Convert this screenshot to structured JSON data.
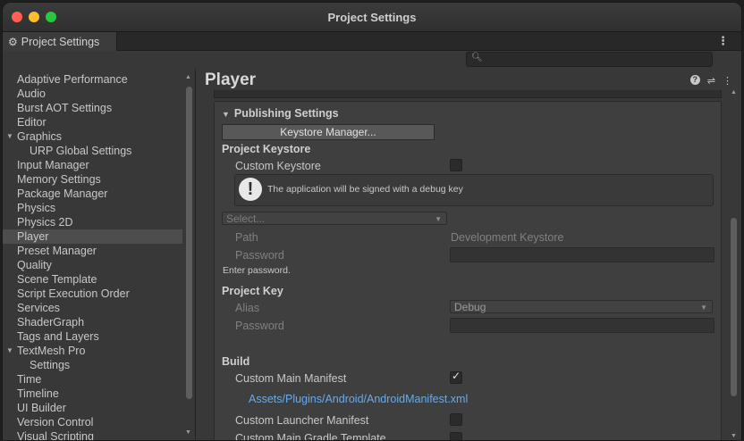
{
  "window": {
    "title": "Project Settings"
  },
  "tab": {
    "label": "Project Settings"
  },
  "search": {
    "placeholder": ""
  },
  "sidebar": {
    "items": [
      {
        "label": "Adaptive Performance"
      },
      {
        "label": "Audio"
      },
      {
        "label": "Burst AOT Settings"
      },
      {
        "label": "Editor"
      },
      {
        "label": "Graphics"
      },
      {
        "label": "URP Global Settings"
      },
      {
        "label": "Input Manager"
      },
      {
        "label": "Memory Settings"
      },
      {
        "label": "Package Manager"
      },
      {
        "label": "Physics"
      },
      {
        "label": "Physics 2D"
      },
      {
        "label": "Player"
      },
      {
        "label": "Preset Manager"
      },
      {
        "label": "Quality"
      },
      {
        "label": "Scene Template"
      },
      {
        "label": "Script Execution Order"
      },
      {
        "label": "Services"
      },
      {
        "label": "ShaderGraph"
      },
      {
        "label": "Tags and Layers"
      },
      {
        "label": "TextMesh Pro"
      },
      {
        "label": "Settings"
      },
      {
        "label": "Time"
      },
      {
        "label": "Timeline"
      },
      {
        "label": "UI Builder"
      },
      {
        "label": "Version Control"
      },
      {
        "label": "Visual Scripting"
      }
    ],
    "selected": "Player"
  },
  "content": {
    "title": "Player",
    "publishing": {
      "header": "Publishing Settings",
      "keystore_manager_button": "Keystore Manager...",
      "project_keystore_label": "Project Keystore",
      "custom_keystore_label": "Custom Keystore",
      "custom_keystore_checked": false,
      "info_message": "The application will be signed with a debug key",
      "select_placeholder": "Select...",
      "path_label": "Path",
      "path_value": "Development Keystore",
      "password_label": "Password",
      "enter_password_hint": "Enter password.",
      "project_key_label": "Project Key",
      "alias_label": "Alias",
      "alias_value": "Debug",
      "key_password_label": "Password",
      "build_label": "Build",
      "custom_main_manifest_label": "Custom Main Manifest",
      "custom_main_manifest_checked": true,
      "manifest_path": "Assets/Plugins/Android/AndroidManifest.xml",
      "custom_launcher_manifest_label": "Custom Launcher Manifest",
      "custom_launcher_manifest_checked": false,
      "custom_main_gradle_label": "Custom Main Gradle Template"
    }
  },
  "colors": {
    "link": "#6aa9ea",
    "selection": "#4d4d4d",
    "panel": "#3f3f3f"
  }
}
